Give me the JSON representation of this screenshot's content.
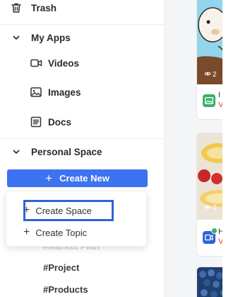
{
  "sidebar": {
    "trash_label": "Trash",
    "my_apps": {
      "label": "My Apps",
      "items": [
        {
          "label": "Videos",
          "icon": "video-icon"
        },
        {
          "label": "Images",
          "icon": "image-icon"
        },
        {
          "label": "Docs",
          "icon": "doc-icon"
        }
      ]
    },
    "personal_space": {
      "label": "Personal Space",
      "create_new_label": "Create New",
      "tags": [
        "#Market Plan",
        "#Project",
        "#Products"
      ]
    }
  },
  "create_menu": {
    "items": [
      "Create Space",
      "Create Topic"
    ]
  },
  "cards": [
    {
      "stat": "2",
      "title_fragment": "I",
      "sub_fragment": "V",
      "app_icon": "image-app-icon",
      "app_color": "#34b36b"
    },
    {
      "stat": "0",
      "title_fragment": "H",
      "sub_fragment": "V",
      "app_icon": "video-app-icon",
      "app_color": "#2f63d8"
    }
  ],
  "colors": {
    "accent": "#3d72f0",
    "highlight": "#2f63d8"
  }
}
